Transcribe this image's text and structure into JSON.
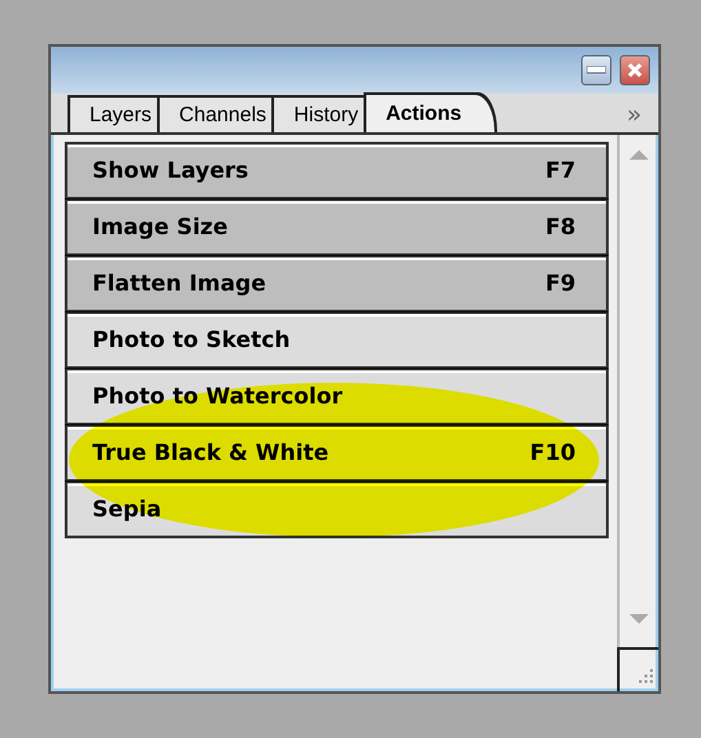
{
  "window": {
    "buttons": [
      {
        "kind": "minimize"
      },
      {
        "kind": "close"
      }
    ]
  },
  "tabs": [
    {
      "label": "Layers",
      "selected": false
    },
    {
      "label": "Channels",
      "selected": false
    },
    {
      "label": "History",
      "selected": false
    },
    {
      "label": "Actions",
      "selected": true
    }
  ],
  "more_button": "»",
  "actions": [
    {
      "name": "Show Layers",
      "shortcut": "F7",
      "selected": true
    },
    {
      "name": "Image Size",
      "shortcut": "F8",
      "selected": true
    },
    {
      "name": "Flatten Image",
      "shortcut": "F9",
      "selected": true
    },
    {
      "name": "Photo to Sketch",
      "selected": false
    },
    {
      "name": "Photo to Watercolor",
      "selected": false
    },
    {
      "name": "True Black & White",
      "shortcut": "F10",
      "selected": false
    },
    {
      "name": "Sepia",
      "selected": false
    }
  ],
  "annotation": {
    "kind": "ellipse",
    "color": "#ffff00"
  }
}
